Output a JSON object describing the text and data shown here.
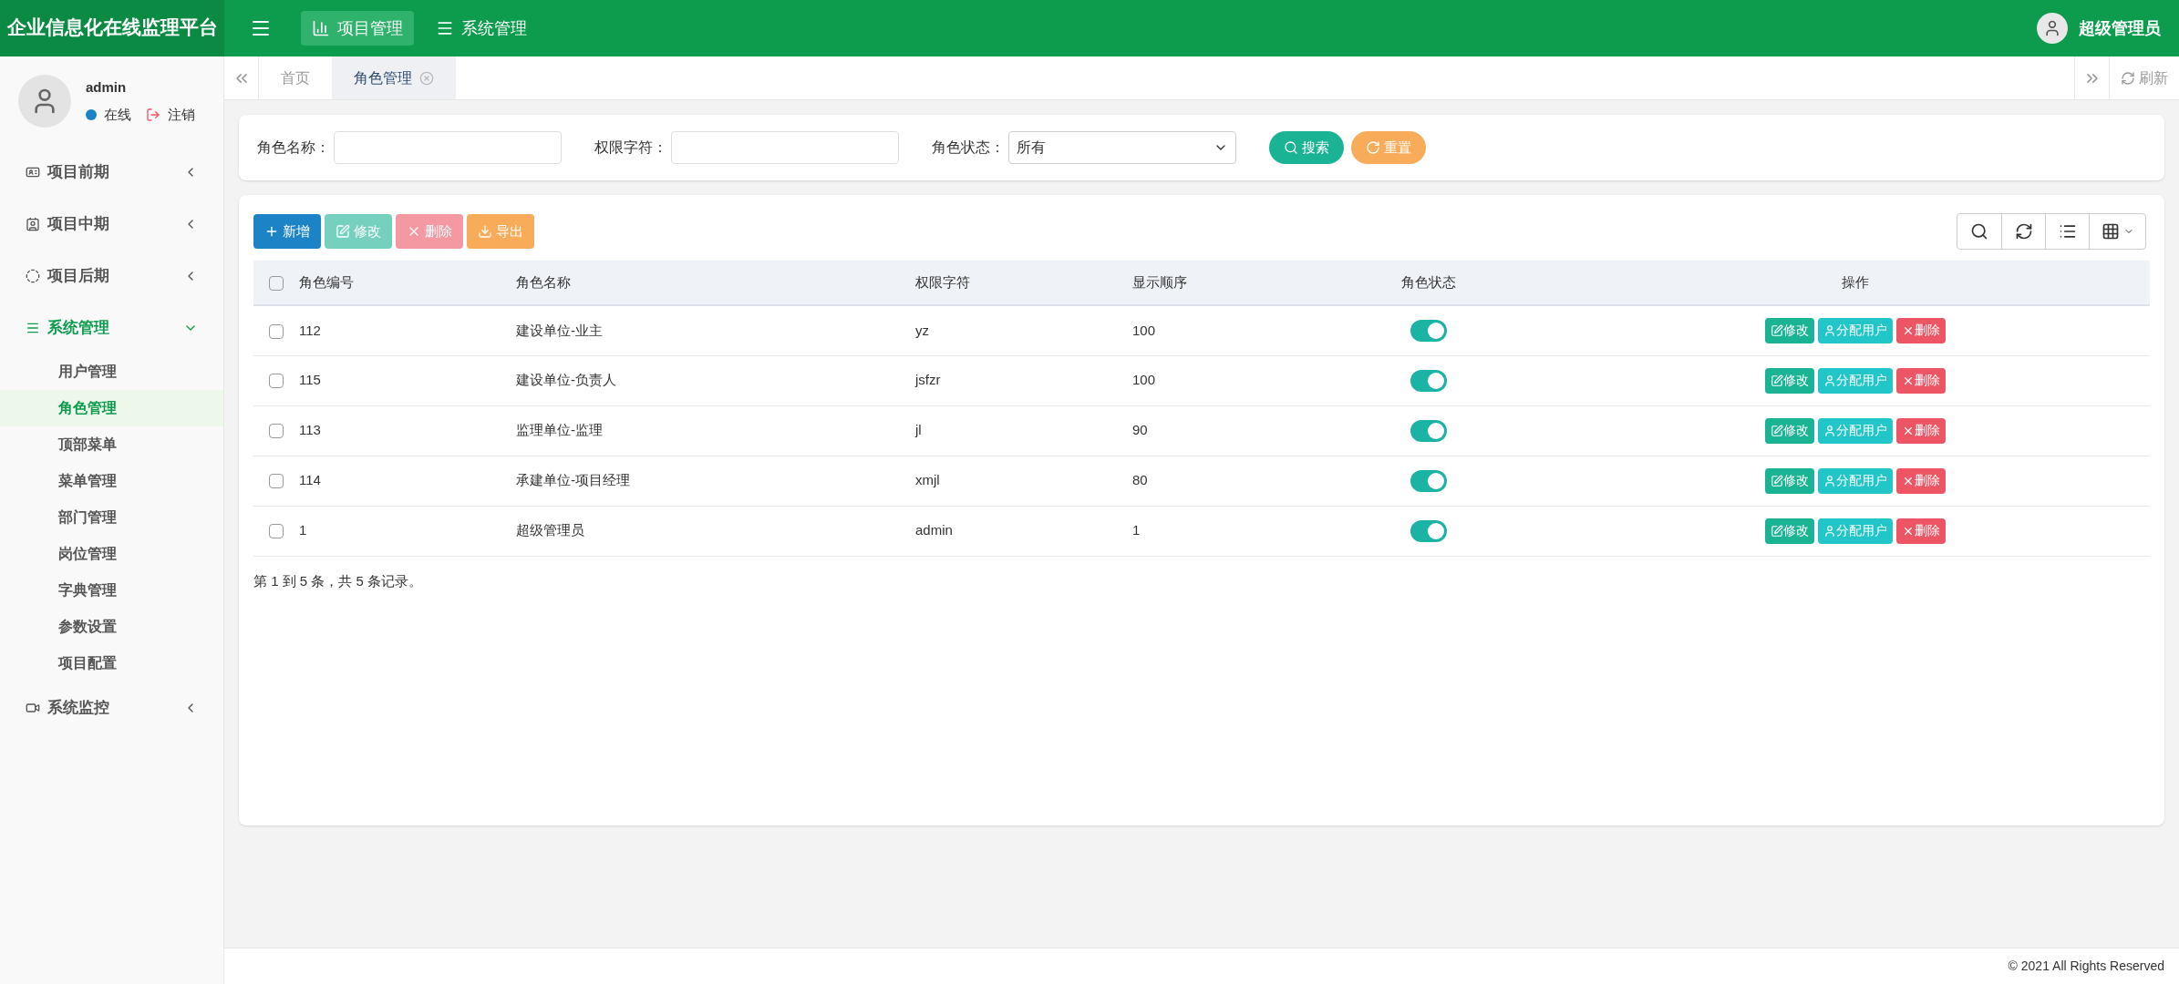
{
  "brand": "企业信息化在线监理平台",
  "top_menu": [
    {
      "label": "项目管理",
      "selected": true,
      "kind": "chart"
    },
    {
      "label": "系统管理",
      "selected": false,
      "kind": "list"
    }
  ],
  "user_menu": {
    "name": "超级管理员"
  },
  "profile": {
    "name": "admin",
    "status": "在线",
    "logout": "注销"
  },
  "sidebar": {
    "items": [
      {
        "label": "项目前期",
        "kind": "card",
        "expanded": false
      },
      {
        "label": "项目中期",
        "kind": "badge",
        "expanded": false
      },
      {
        "label": "项目后期",
        "kind": "half",
        "expanded": false
      },
      {
        "label": "系统管理",
        "kind": "list",
        "expanded": true,
        "children": [
          {
            "label": "用户管理",
            "selected": false
          },
          {
            "label": "角色管理",
            "selected": true
          },
          {
            "label": "顶部菜单",
            "selected": false
          },
          {
            "label": "菜单管理",
            "selected": false
          },
          {
            "label": "部门管理",
            "selected": false
          },
          {
            "label": "岗位管理",
            "selected": false
          },
          {
            "label": "字典管理",
            "selected": false
          },
          {
            "label": "参数设置",
            "selected": false
          },
          {
            "label": "项目配置",
            "selected": false
          }
        ]
      },
      {
        "label": "系统监控",
        "kind": "video",
        "expanded": false
      }
    ]
  },
  "tabs": [
    {
      "label": "首页",
      "selected": false,
      "closable": false
    },
    {
      "label": "角色管理",
      "selected": true,
      "closable": true
    }
  ],
  "refresh": "刷新",
  "search_form": {
    "fields": [
      {
        "label": "角色名称：",
        "kind": "text"
      },
      {
        "label": "权限字符：",
        "kind": "text"
      },
      {
        "label": "角色状态：",
        "kind": "select",
        "value": "所有"
      }
    ],
    "search": "搜索",
    "reset": "重置"
  },
  "toolbar": [
    {
      "label": "新增",
      "kind": "add",
      "disabled": false
    },
    {
      "label": "修改",
      "kind": "edit",
      "disabled": true
    },
    {
      "label": "删除",
      "kind": "delete",
      "disabled": true
    },
    {
      "label": "导出",
      "kind": "export",
      "disabled": false
    }
  ],
  "table": {
    "select_all": {
      "checked": false
    },
    "columns": [
      "角色编号",
      "角色名称",
      "权限字符",
      "显示顺序",
      "角色状态",
      "操作"
    ],
    "rows": [
      {
        "id": "112",
        "name": "建设单位-业主",
        "key": "yz",
        "order": "100",
        "on": true,
        "checked": false,
        "actions": [
          "修改",
          "分配用户",
          "删除"
        ]
      },
      {
        "id": "115",
        "name": "建设单位-负责人",
        "key": "jsfzr",
        "order": "100",
        "on": true,
        "checked": false,
        "actions": [
          "修改",
          "分配用户",
          "删除"
        ]
      },
      {
        "id": "113",
        "name": "监理单位-监理",
        "key": "jl",
        "order": "90",
        "on": true,
        "checked": false,
        "actions": [
          "修改",
          "分配用户",
          "删除"
        ]
      },
      {
        "id": "114",
        "name": "承建单位-项目经理",
        "key": "xmjl",
        "order": "80",
        "on": true,
        "checked": false,
        "actions": [
          "修改",
          "分配用户",
          "删除"
        ]
      },
      {
        "id": "1",
        "name": "超级管理员",
        "key": "admin",
        "order": "1",
        "on": true,
        "checked": false,
        "actions": [
          "修改",
          "分配用户",
          "删除"
        ]
      }
    ],
    "summary": "第 1 到 5 条，共 5 条记录。"
  },
  "footer": "© 2021 All Rights Reserved"
}
